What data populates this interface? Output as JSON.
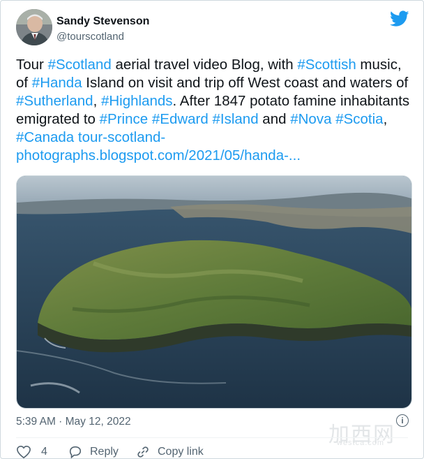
{
  "tweet": {
    "author_name": "Sandy Stevenson",
    "author_handle": "@tourscotland",
    "icon_logo": "bird-icon",
    "body": [
      {
        "t": "Tour "
      },
      {
        "t": "#Scotland",
        "tag": true
      },
      {
        "t": " aerial travel video Blog, with "
      },
      {
        "t": "#Scottish",
        "tag": true
      },
      {
        "t": " music, of "
      },
      {
        "t": "#Handa",
        "tag": true
      },
      {
        "t": " Island on visit and trip off West coast and waters of "
      },
      {
        "t": "#Sutherland",
        "tag": true
      },
      {
        "t": ", "
      },
      {
        "t": "#Highlands",
        "tag": true
      },
      {
        "t": ". After 1847 potato famine inhabitants emigrated to "
      },
      {
        "t": "#Prince",
        "tag": true
      },
      {
        "t": " "
      },
      {
        "t": "#Edward",
        "tag": true
      },
      {
        "t": " "
      },
      {
        "t": "#Island",
        "tag": true
      },
      {
        "t": " and "
      },
      {
        "t": "#Nova",
        "tag": true
      },
      {
        "t": " "
      },
      {
        "t": "#Scotia",
        "tag": true
      },
      {
        "t": ", "
      },
      {
        "t": "#Canada",
        "tag": true
      },
      {
        "t": " "
      },
      {
        "t": "tour-scotland-photographs.blogspot.com/2021/05/handa-...",
        "tag": true
      }
    ],
    "timestamp": "5:39 AM · May 12, 2022",
    "info_glyph": "i",
    "likes_count": "4",
    "reply_label": "Reply",
    "copy_link_label": "Copy link"
  },
  "watermark": {
    "main": "加西网",
    "sub": "westca.com"
  },
  "colors": {
    "accent": "#1d9bf0",
    "text": "#0f1419",
    "muted": "#536471",
    "like": "#536471"
  }
}
